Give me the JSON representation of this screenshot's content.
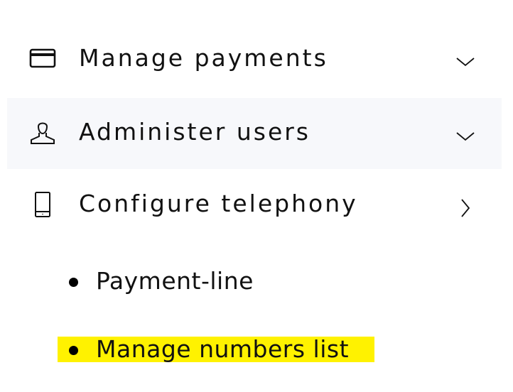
{
  "menu": {
    "items": [
      {
        "label": "Manage payments",
        "icon": "credit-card-icon",
        "chevron": "chevron-down-icon"
      },
      {
        "label": "Administer users",
        "icon": "user-icon",
        "chevron": "chevron-down-icon"
      },
      {
        "label": "Configure telephony",
        "icon": "mobile-phone-icon",
        "chevron": "chevron-right-icon"
      }
    ],
    "submenu": [
      {
        "label": "Payment-line"
      },
      {
        "label": "Manage numbers list",
        "highlight_color": "#fff200"
      }
    ],
    "hover_row_color": "#f7f8fb"
  }
}
